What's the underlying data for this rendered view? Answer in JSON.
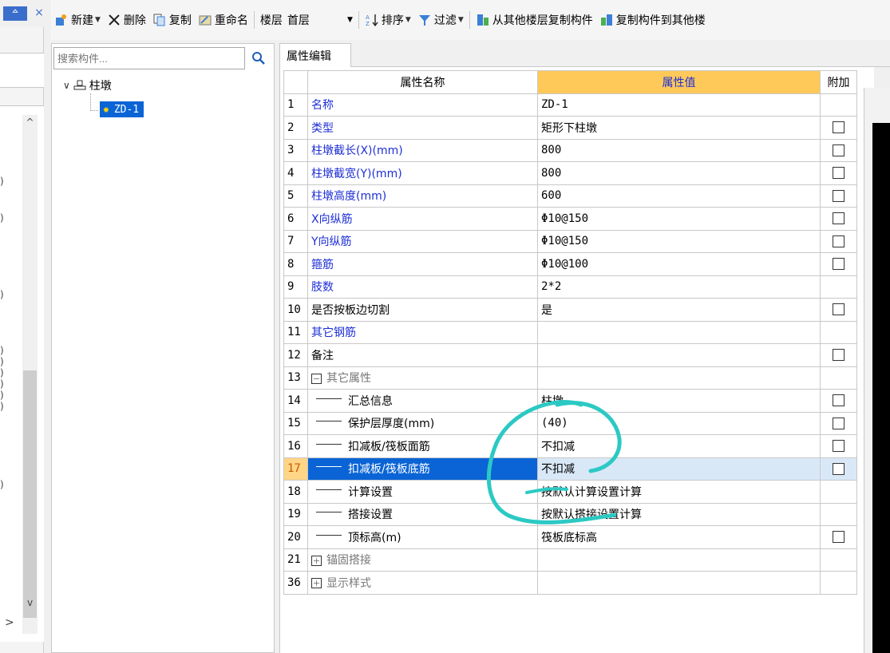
{
  "panel": {
    "pin_label": "ᅀ",
    "close_label": "×"
  },
  "toolbar": {
    "new_label": "新建",
    "delete_label": "删除",
    "copy_label": "复制",
    "rename_label": "重命名",
    "floor_label": "楼层",
    "floor_value": "首层",
    "sort_label": "排序",
    "filter_label": "过滤",
    "copy_from_label": "从其他楼层复制构件",
    "copy_to_label": "复制构件到其他楼"
  },
  "search": {
    "placeholder": "搜索构件..."
  },
  "tree": {
    "root_label": "柱墩",
    "child_label": "ZD-1"
  },
  "tab": {
    "label": "属性编辑"
  },
  "grid": {
    "headers": {
      "num": "",
      "name": "属性名称",
      "value": "属性值",
      "add": "附加"
    },
    "rows": [
      {
        "num": "1",
        "name": "名称",
        "value": "ZD-1",
        "style": "blue",
        "check": false
      },
      {
        "num": "2",
        "name": "类型",
        "value": "矩形下柱墩",
        "style": "blue",
        "check": true
      },
      {
        "num": "3",
        "name": "柱墩截长(X)(mm)",
        "value": "800",
        "style": "blue",
        "check": true
      },
      {
        "num": "4",
        "name": "柱墩截宽(Y)(mm)",
        "value": "800",
        "style": "blue",
        "check": true
      },
      {
        "num": "5",
        "name": "柱墩高度(mm)",
        "value": "600",
        "style": "blue",
        "check": true
      },
      {
        "num": "6",
        "name": "X向纵筋",
        "value": "Φ10@150",
        "style": "blue",
        "check": true
      },
      {
        "num": "7",
        "name": "Y向纵筋",
        "value": "Φ10@150",
        "style": "blue",
        "check": true
      },
      {
        "num": "8",
        "name": "箍筋",
        "value": "Φ10@100",
        "style": "blue",
        "check": true
      },
      {
        "num": "9",
        "name": "肢数",
        "value": "2*2",
        "style": "blue",
        "check": false
      },
      {
        "num": "10",
        "name": "是否按板边切割",
        "value": "是",
        "style": "black",
        "check": true
      },
      {
        "num": "11",
        "name": "其它钢筋",
        "value": "",
        "style": "blue",
        "check": false
      },
      {
        "num": "12",
        "name": "备注",
        "value": "",
        "style": "black",
        "check": true
      },
      {
        "num": "13",
        "name": "其它属性",
        "value": "",
        "style": "group-open",
        "check": false
      },
      {
        "num": "14",
        "name": "汇总信息",
        "value": "柱墩",
        "style": "child",
        "check": true
      },
      {
        "num": "15",
        "name": "保护层厚度(mm)",
        "value": "(40)",
        "style": "child",
        "check": true
      },
      {
        "num": "16",
        "name": "扣减板/筏板面筋",
        "value": "不扣减",
        "style": "child",
        "check": true
      },
      {
        "num": "17",
        "name": "扣减板/筏板底筋",
        "value": "不扣减",
        "style": "child-selected",
        "check": true
      },
      {
        "num": "18",
        "name": "计算设置",
        "value": "按默认计算设置计算",
        "style": "child",
        "check": false
      },
      {
        "num": "19",
        "name": "搭接设置",
        "value": "按默认搭接设置计算",
        "style": "child",
        "check": false
      },
      {
        "num": "20",
        "name": "顶标高(m)",
        "value": "筏板底标高",
        "style": "child",
        "check": true
      },
      {
        "num": "21",
        "name": "锚固搭接",
        "value": "",
        "style": "group-closed",
        "check": false
      },
      {
        "num": "36",
        "name": "显示样式",
        "value": "",
        "style": "group-closed",
        "check": false
      }
    ]
  },
  "colors": {
    "accent": "#0a64d6",
    "header_value_bg": "#ffc95a",
    "link_blue": "#1d2fd6",
    "annotation": "#2cc9c4"
  }
}
